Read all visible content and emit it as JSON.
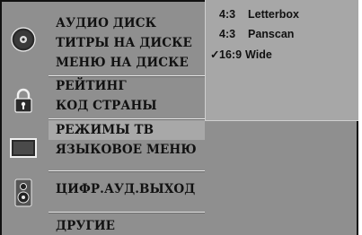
{
  "menu": {
    "groups": [
      {
        "icon": "disc-icon",
        "items": [
          "АУДИО ДИСК",
          "ТИТРЫ НА ДИСКЕ",
          "МЕНЮ НА ДИСКЕ"
        ]
      },
      {
        "icon": "padlock-icon",
        "items": [
          "РЕЙТИНГ",
          "КОД СТРАНЫ"
        ]
      },
      {
        "icon": "tv-screen-icon",
        "items": [
          "РЕЖИМЫ ТВ",
          "ЯЗЫКОВОЕ МЕНЮ"
        ]
      },
      {
        "icon": "speaker-icon",
        "items": [
          "ЦИФР.АУД.ВЫХОД"
        ]
      },
      {
        "icon": "none",
        "items": [
          "ДРУГИЕ"
        ]
      }
    ],
    "selected_item": "РЕЖИМЫ ТВ"
  },
  "submenu": {
    "options": [
      {
        "aspect": "4:3",
        "name": "Letterbox",
        "checked": false
      },
      {
        "aspect": "4:3",
        "name": "Panscan",
        "checked": false
      },
      {
        "aspect": "16:9",
        "name": "Wide",
        "checked": true
      }
    ],
    "check_mark": "✓"
  },
  "colors": {
    "background": "#8f8f8f",
    "submenu_background": "#a7a7a7",
    "selected_row": "#a8a8a8",
    "text": "#111111"
  }
}
